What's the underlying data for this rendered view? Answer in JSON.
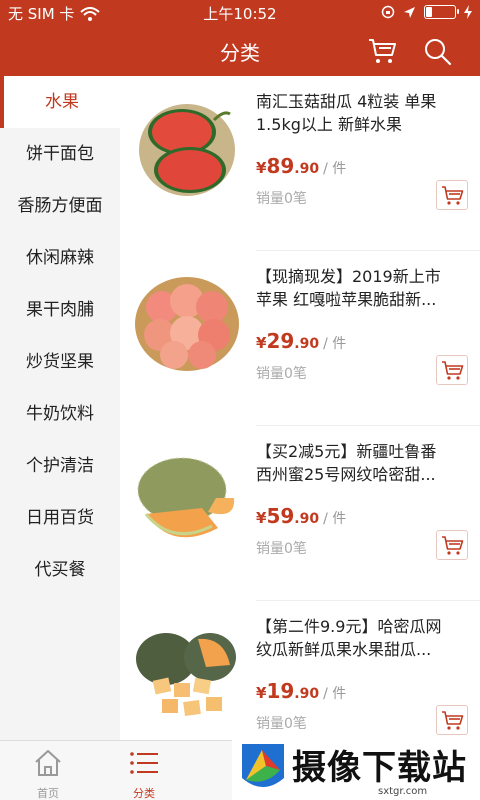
{
  "status_bar": {
    "carrier": "无 SIM 卡",
    "time": "上午10:52"
  },
  "header": {
    "title": "分类",
    "cart_icon": "cart-icon",
    "search_icon": "search-icon"
  },
  "colors": {
    "brand": "#c13a20",
    "sidebar_bg": "#f4f4f4",
    "price": "#c13a20"
  },
  "sidebar": {
    "items": [
      {
        "label": "水果",
        "active": true
      },
      {
        "label": "饼干面包"
      },
      {
        "label": "香肠方便面"
      },
      {
        "label": "休闲麻辣"
      },
      {
        "label": "果干肉脯"
      },
      {
        "label": "炒货坚果"
      },
      {
        "label": "牛奶饮料"
      },
      {
        "label": "个护清洁"
      },
      {
        "label": "日用百货"
      },
      {
        "label": "代买餐"
      }
    ]
  },
  "products": [
    {
      "name_line1": "南汇玉菇甜瓜 4粒装 单果",
      "name_line2": "1.5kg以上 新鲜水果",
      "currency": "¥",
      "price_int": "89",
      "price_dec": ".90",
      "unit": "/ 件",
      "sales": "销量0笔",
      "image": "watermelon-image"
    },
    {
      "name_line1": "【现摘现发】2019新上市",
      "name_line2": "苹果 红嘎啦苹果脆甜新...",
      "currency": "¥",
      "price_int": "29",
      "price_dec": ".90",
      "unit": "/ 件",
      "sales": "销量0笔",
      "image": "apple-image"
    },
    {
      "name_line1": "【买2减5元】新疆吐鲁番",
      "name_line2": "西州蜜25号网纹哈密甜...",
      "currency": "¥",
      "price_int": "59",
      "price_dec": ".90",
      "unit": "/ 件",
      "sales": "销量0笔",
      "image": "hami-melon-image"
    },
    {
      "name_line1": "【第二件9.9元】哈密瓜网",
      "name_line2": "纹瓜新鲜瓜果水果甜瓜...",
      "currency": "¥",
      "price_int": "19",
      "price_dec": ".90",
      "unit": "/ 件",
      "sales": "销量0笔",
      "image": "cantaloupe-image"
    }
  ],
  "tabbar": {
    "tabs": [
      {
        "label": "首页",
        "icon": "home-icon"
      },
      {
        "label": "分类",
        "icon": "category-icon",
        "active": true
      }
    ]
  },
  "watermark": {
    "text": "摄像下载站",
    "domain": "sxtgr.com"
  }
}
